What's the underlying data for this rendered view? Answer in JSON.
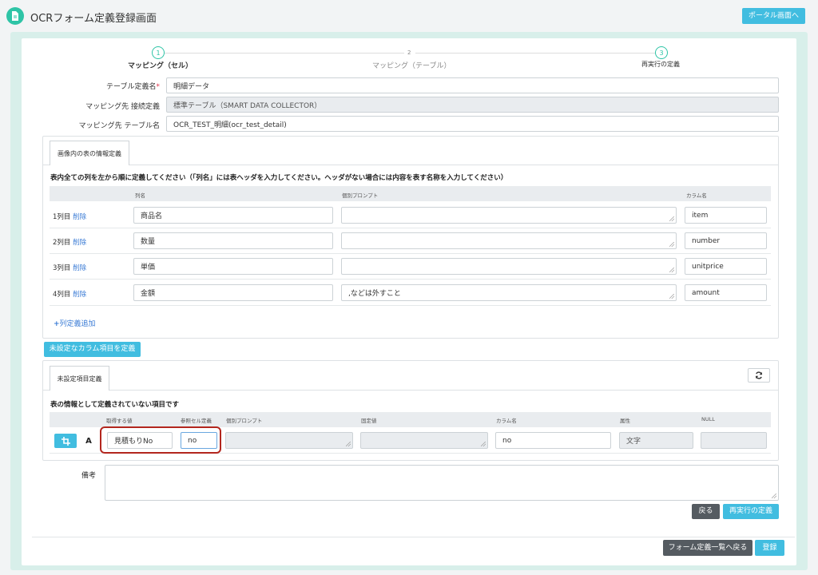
{
  "header": {
    "title": "OCRフォーム定義登録画面",
    "portal_label": "ポータル画面へ"
  },
  "steps": [
    {
      "num": "1",
      "label": "マッピング（セル）"
    },
    {
      "num": "2",
      "label": "マッピング（テーブル）"
    },
    {
      "num": "3",
      "label": "再実行の定義"
    }
  ],
  "form": {
    "table_def_label": "テーブル定義名",
    "table_def_required": "*",
    "table_def_value": "明細データ",
    "mapping_conn_label": "マッピング先 接続定義",
    "mapping_conn_value": "標準テーブル（SMART DATA COLLECTOR）",
    "mapping_table_label": "マッピング先 テーブル名",
    "mapping_table_value": "OCR_TEST_明細(ocr_test_detail)"
  },
  "table_info": {
    "tab_label": "画像内の表の情報定義",
    "instruction": "表内全ての列を左から順に定義してください（「列名」には表ヘッダを入力してください。ヘッダがない場合には内容を表す名称を入力してください）",
    "headers": {
      "col_name": "列名",
      "prompt": "個別プロンプト",
      "column": "カラム名"
    },
    "delete_label": "削除",
    "rows": [
      {
        "label": "1列目",
        "name": "商品名",
        "prompt": "",
        "column": "item"
      },
      {
        "label": "2列目",
        "name": "数量",
        "prompt": "",
        "column": "number"
      },
      {
        "label": "3列目",
        "name": "単価",
        "prompt": "",
        "column": "unitprice"
      },
      {
        "label": "4列目",
        "name": "金額",
        "prompt": ",などは外すこと",
        "column": "amount"
      }
    ],
    "add_label": "列定義追加",
    "add_icon": "plus-icon"
  },
  "define_unset_label": "未設定なカラム項目を定義",
  "unset": {
    "tab_label": "未設定項目定義",
    "refresh_icon": "refresh-icon",
    "title": "表の情報として定義されていない項目です",
    "headers": {
      "get_value": "取得する値",
      "ref_cell": "参照セル定義",
      "prompt": "個別プロンプト",
      "fixed": "固定値",
      "column": "カラム名",
      "attr": "属性",
      "null": "NULL"
    },
    "row": {
      "crop_icon": "crop-icon",
      "text_icon": "A",
      "get_value": "見積もりNo",
      "ref_cell": "no",
      "prompt": "",
      "fixed": "",
      "column": "no",
      "attr": "文字",
      "null": ""
    }
  },
  "remarks": {
    "label": "備考",
    "value": ""
  },
  "buttons": {
    "back": "戻る",
    "rerun": "再実行の定義",
    "back_list": "フォーム定義一覧へ戻る",
    "register": "登録"
  },
  "colors": {
    "accent": "#41bde0",
    "brand": "#2ec4a6",
    "highlight": "#b3261e",
    "dark_button": "#555b61"
  }
}
